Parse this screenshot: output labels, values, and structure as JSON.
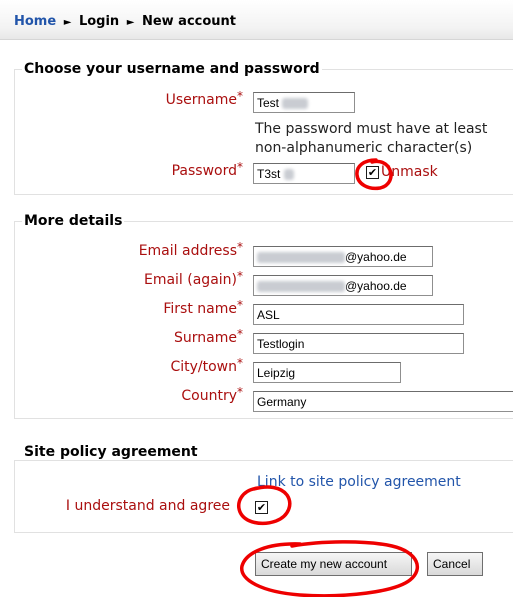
{
  "breadcrumb": {
    "home": "Home",
    "separator": "►",
    "login": "Login",
    "current": "New account"
  },
  "section_username": {
    "legend": "Choose your username and password",
    "username_label": "Username",
    "username_value": "Test",
    "password_hint_line1": "The password must have at least",
    "password_hint_line2": "non-alphanumeric character(s)",
    "password_label": "Password",
    "password_value": "T3st",
    "unmask_label": "Unmask",
    "unmask_checked": "✔"
  },
  "section_details": {
    "legend": "More details",
    "email_label": "Email address",
    "email_suffix": "@yahoo.de",
    "email_again_label": "Email (again)",
    "email_again_suffix": "@yahoo.de",
    "firstname_label": "First name",
    "firstname_value": "ASL",
    "surname_label": "Surname",
    "surname_value": "Testlogin",
    "city_label": "City/town",
    "city_value": "Leipzig",
    "country_label": "Country",
    "country_value": "Germany"
  },
  "section_policy": {
    "legend": "Site policy agreement",
    "link_text": "Link to site policy agreement",
    "agree_label": "I understand and agree",
    "agree_checked": "✔"
  },
  "required_marker": "*",
  "buttons": {
    "create": "Create my new account",
    "cancel": "Cancel"
  },
  "colors": {
    "label_red": "#aa0f0f",
    "link_blue": "#2255aa",
    "annotation_red": "#ee0000"
  }
}
